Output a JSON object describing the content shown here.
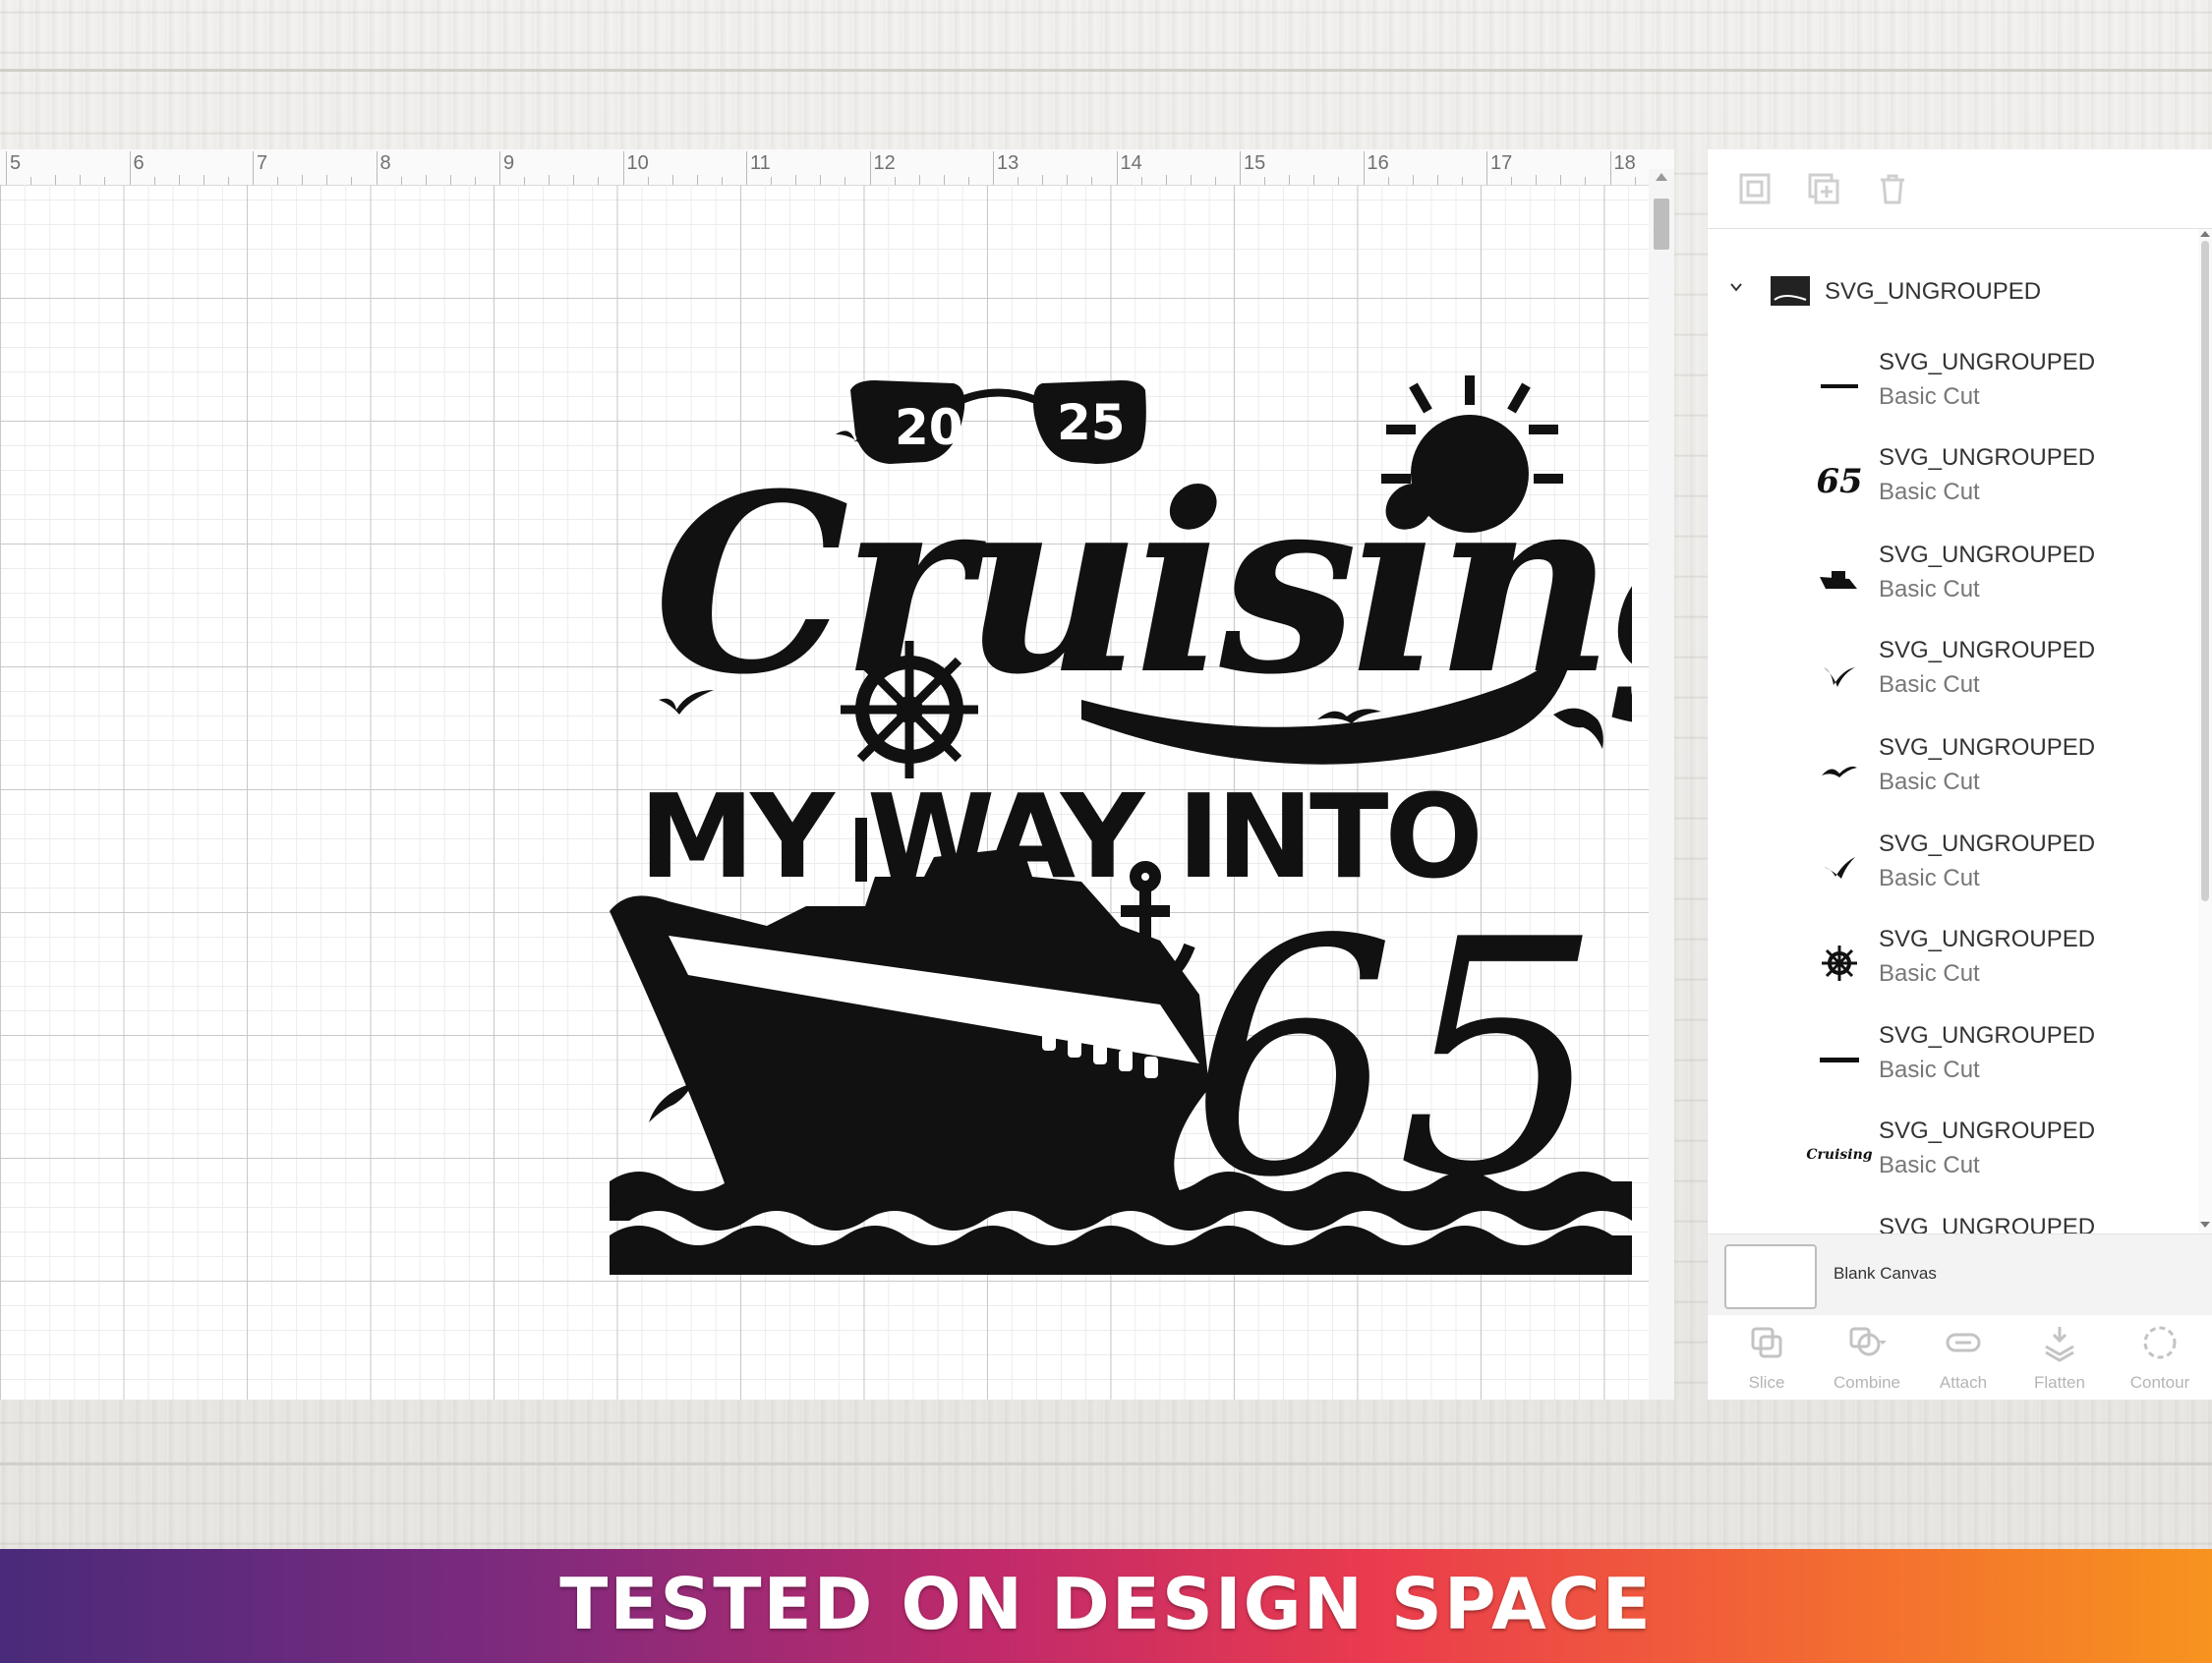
{
  "ruler": {
    "marks": [
      "5",
      "6",
      "7",
      "8",
      "9",
      "10",
      "11",
      "12",
      "13",
      "14",
      "15",
      "16",
      "17",
      "18"
    ]
  },
  "design": {
    "year_left": "20",
    "year_right": "25",
    "word_cruising": "Cruising",
    "line_my_way_into": "MY WAY INTO",
    "number": "65"
  },
  "layers_panel": {
    "group_name": "SVG_UNGROUPED",
    "layers": [
      {
        "name": "SVG_UNGROUPED",
        "op": "Basic Cut",
        "thumb": "line-icon"
      },
      {
        "name": "SVG_UNGROUPED",
        "op": "Basic Cut",
        "thumb": "65-text"
      },
      {
        "name": "SVG_UNGROUPED",
        "op": "Basic Cut",
        "thumb": "ship-icon"
      },
      {
        "name": "SVG_UNGROUPED",
        "op": "Basic Cut",
        "thumb": "bird-icon"
      },
      {
        "name": "SVG_UNGROUPED",
        "op": "Basic Cut",
        "thumb": "bird-icon"
      },
      {
        "name": "SVG_UNGROUPED",
        "op": "Basic Cut",
        "thumb": "bird-icon"
      },
      {
        "name": "SVG_UNGROUPED",
        "op": "Basic Cut",
        "thumb": "wheel-icon"
      },
      {
        "name": "SVG_UNGROUPED",
        "op": "Basic Cut",
        "thumb": "text-icon"
      },
      {
        "name": "SVG_UNGROUPED",
        "op": "Basic Cut",
        "thumb": "cruising-icon"
      },
      {
        "name": "SVG_UNGROUPED",
        "op": "",
        "thumb": "misc-icon"
      }
    ],
    "thumb_65": "65",
    "thumb_cruising": "Cruising",
    "blank_canvas": "Blank Canvas"
  },
  "actions": {
    "slice": "Slice",
    "combine": "Combine",
    "attach": "Attach",
    "flatten": "Flatten",
    "contour": "Contour"
  },
  "banner": {
    "text": "TESTED ON DESIGN SPACE"
  },
  "colors": {
    "ink": "#111111",
    "banner_start": "#4a2a7a",
    "banner_end": "#f7931e"
  }
}
